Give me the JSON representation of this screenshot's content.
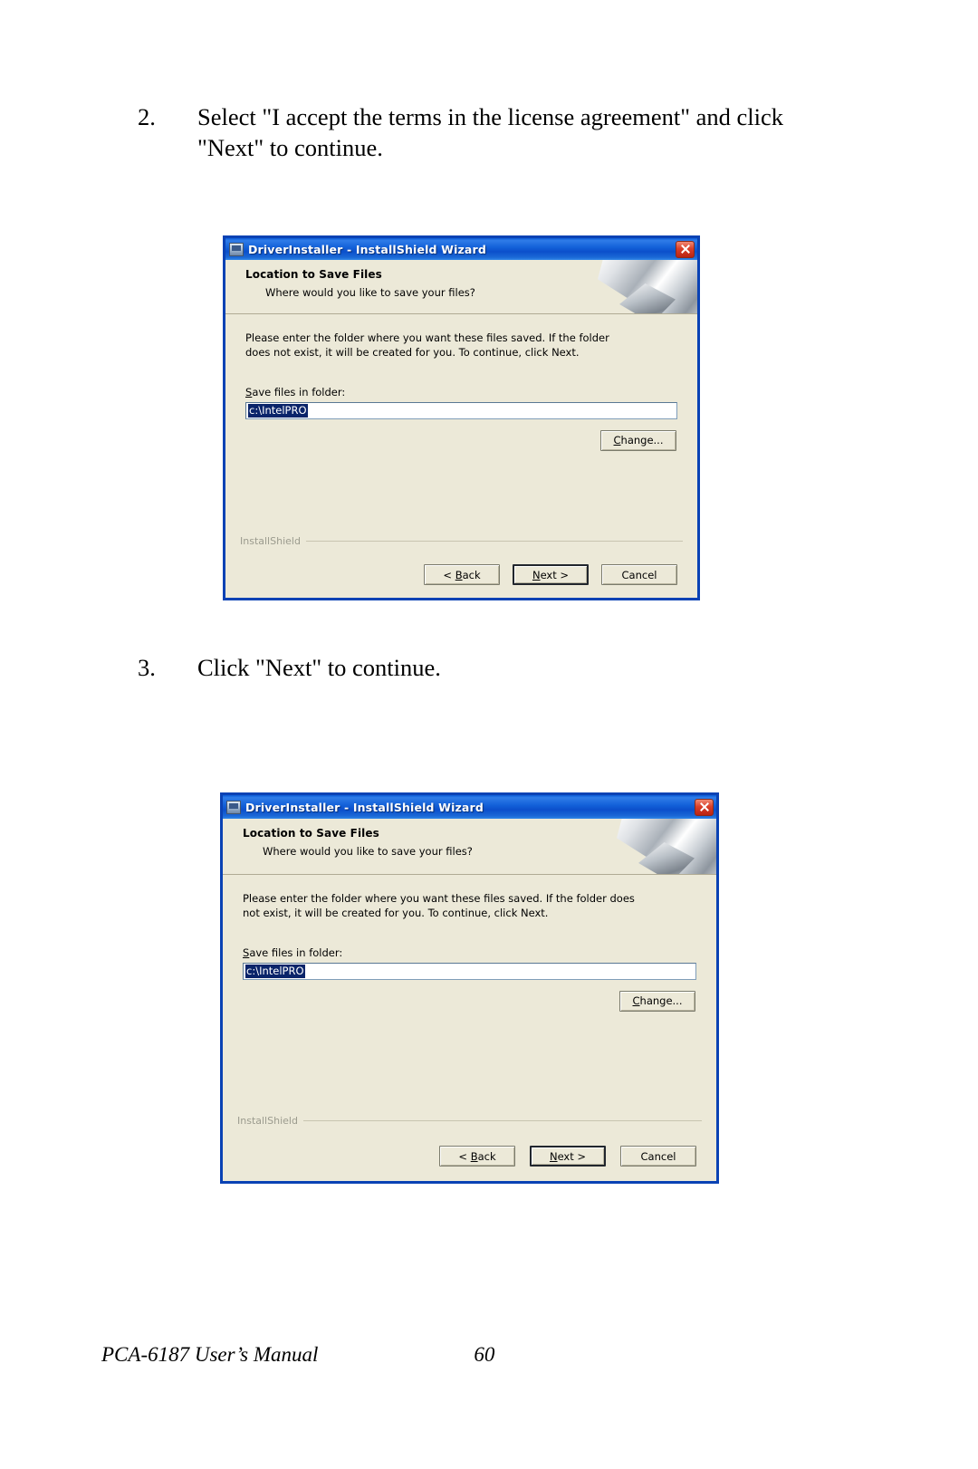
{
  "document": {
    "footer_manual": "PCA-6187 User’s Manual",
    "footer_page": "60"
  },
  "steps": [
    {
      "number": "2.",
      "text": "Select \"I accept the terms in the license agreement\" and click \"Next\" to continue."
    },
    {
      "number": "3.",
      "text": "Click \"Next\" to continue."
    }
  ],
  "dialog": {
    "title": "DriverInstaller - InstallShield Wizard",
    "close_label": "×",
    "banner_title": "Location to Save Files",
    "banner_subtitle": "Where would you like to save your files?",
    "paragraph": "Please enter the folder where you want these files saved.  If the folder does not exist, it will be created for you.   To continue, click Next.",
    "field_label_underlined": "S",
    "field_label_rest": "ave files in folder:",
    "path_value": "c:\\IntelPRO",
    "change_label_underlined": "C",
    "change_label_rest": "hange...",
    "installshield_label": "InstallShield",
    "buttons": {
      "back_underlined": "B",
      "back_prefix": "< ",
      "back_rest": "ack",
      "next_underlined": "N",
      "next_rest": "ext >",
      "cancel": "Cancel"
    }
  }
}
